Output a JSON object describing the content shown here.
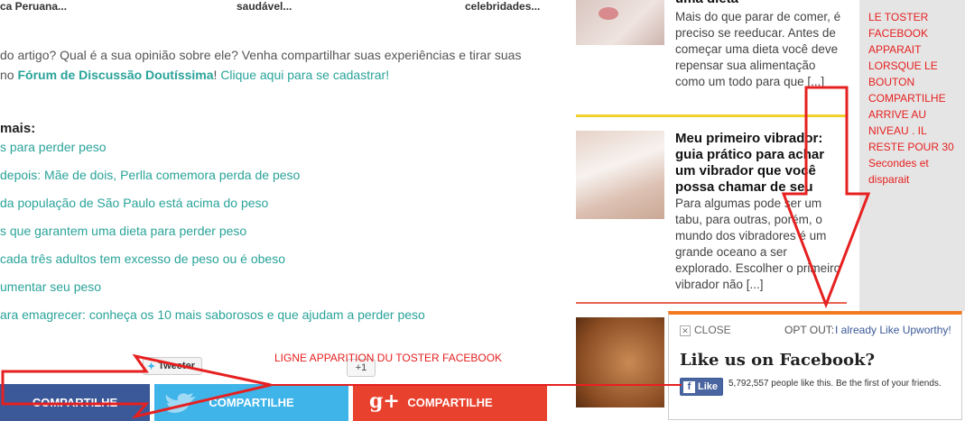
{
  "top_links": [
    "ca Peruana...",
    "saudável...",
    "celebridades..."
  ],
  "article_prompt": {
    "line1": "do artigo? Qual é a sua opinião sobre ele? Venha compartilhar suas experiências e tirar suas",
    "line2_prefix": "no ",
    "forum": "Fórum de Discussão Doutíssima",
    "line2_mid": "! ",
    "cta": "Clique aqui para se cadastrar!"
  },
  "related": {
    "heading": "mais:",
    "items": [
      "s para perder peso",
      "depois: Mãe de dois, Perlla comemora perda de peso",
      "da população de São Paulo está acima do peso",
      "s que garantem uma dieta para perder peso",
      "cada três adultos tem excesso de peso ou é obeso",
      "umentar seu peso",
      "ara emagrecer: conheça os 10 mais saborosos e que ajudam a perder peso"
    ]
  },
  "sidebar": {
    "card1": {
      "title_partial": "uma dieta",
      "excerpt": "Mais do que parar de comer, é preciso se reeducar. Antes de começar uma dieta você deve repensar sua alimentação como um todo para que [...]"
    },
    "card2": {
      "title": "Meu primeiro vibrador: guia prático para achar um vibrador que você possa chamar de seu",
      "excerpt": "Para algumas pode ser um tabu, para outras, porém, o mundo dos vibradores é um grande oceano a ser explorado. Escolher o primeiro vibrador não [...]"
    }
  },
  "share_bar": {
    "facebook_label": "COMPARTILHE",
    "twitter_label": "COMPARTILHE",
    "gplus_label": "COMPARTILHE",
    "gplus_glyph": "g+",
    "tweet_label": "Tweeter",
    "plusone_label": "+1"
  },
  "annotations": {
    "right_note": "LE TOSTER FACEBOOK APPARAIT LORSQUE LE BOUTON COMPARTILHE ARRIVE AU NIVEAU . IL RESTE POUR 30 Secondes et disparait",
    "line_note": "LIGNE APPARITION DU TOSTER FACEBOOK"
  },
  "fb_toaster": {
    "close_label": "CLOSE",
    "optout_label": "OPT OUT:",
    "optout_link": "I already Like Upworthy!",
    "heading": "Like us on Facebook?",
    "like_label": "Like",
    "like_text": "5,792,557 people like this. Be the first of your friends."
  },
  "colors": {
    "accent_teal": "#2aa39a",
    "facebook": "#3b5998",
    "twitter": "#3fb4e9",
    "gplus": "#e8422e",
    "annotation_red": "#e62020",
    "toaster_orange": "#f47a20"
  }
}
